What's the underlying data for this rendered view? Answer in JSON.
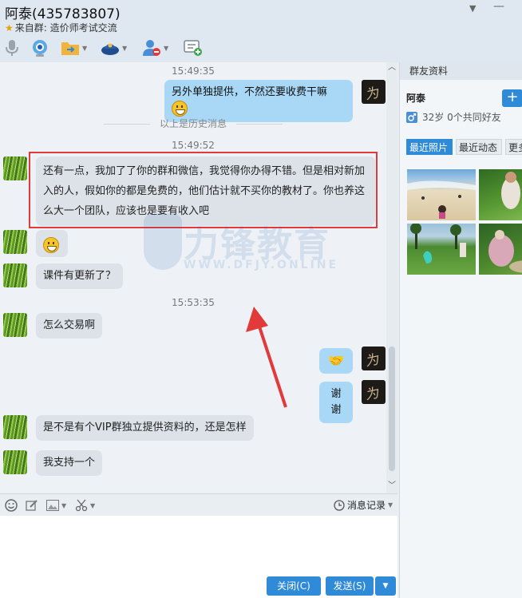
{
  "window": {
    "title": "阿泰(435783807)",
    "group_prefix": "来自群:",
    "group_name": "造价师考试交流"
  },
  "chat": {
    "history_label": "以上是历史消息",
    "timestamps": [
      "15:49:35",
      "15:49:52",
      "15:53:35"
    ],
    "messages": [
      {
        "side": "right",
        "text": "另外单独提供，不然还要收费干嘛"
      },
      {
        "side": "left",
        "text": "还有一点，我加了了你的群和微信，我觉得你办得不错。但是相对新加入的人，假如你的都是免费的，他们估计就不买你的教材了。你也养这么大一个团队，应该也是要有收入吧"
      },
      {
        "side": "left",
        "text": ""
      },
      {
        "side": "left",
        "text": "课件有更新了？"
      },
      {
        "side": "left",
        "text": "怎么交易啊"
      },
      {
        "side": "right",
        "text": ""
      },
      {
        "side": "right",
        "text": "谢谢"
      },
      {
        "side": "left",
        "text": "是不是有个VIP群独立提供资料的，还是怎样"
      },
      {
        "side": "left",
        "text": "我支持一个"
      }
    ]
  },
  "watermark": {
    "brand": "力锋教育",
    "url": "WWW.DFJY.ONLINE",
    "registered": "®"
  },
  "input_toolbar": {
    "history_label": "消息记录"
  },
  "buttons": {
    "close_label": "关闭(C)",
    "send_label": "发送(S)"
  },
  "profile_panel": {
    "header": "群友资料",
    "name": "阿泰",
    "add_label": "+",
    "info": "32岁 0个共同好友",
    "tabs": [
      "最近照片",
      "最近动态",
      "更多"
    ]
  },
  "colors": {
    "accent": "#2f8ad8",
    "bubble_self": "#a8d8f6",
    "bubble_other": "#dde2e8",
    "highlight": "#e23a3a"
  }
}
